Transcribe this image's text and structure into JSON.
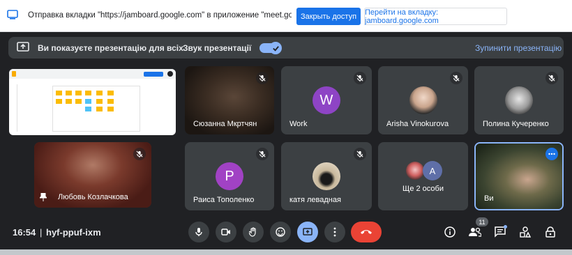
{
  "share_bar": {
    "message": "Отправка вкладки \"https://jamboard.google.com\" в приложение \"meet.google.com\"...",
    "stop_button": "Закрыть доступ",
    "switch_button": "Перейти на вкладку: jamboard.google.com"
  },
  "presentation_bar": {
    "status": "Ви показуєте презентацію для всіх",
    "sound_label": "Звук презентації",
    "sound_on": true,
    "stop_link": "Зупинити презентацію"
  },
  "tiles": [
    {
      "name": "Сюзанна Мкртчян",
      "type": "video",
      "muted": true
    },
    {
      "name": "Work",
      "type": "avatar",
      "initial": "W",
      "color": "#8e44c5",
      "muted": true
    },
    {
      "name": "Arisha Vinokurova",
      "type": "photo",
      "muted": true
    },
    {
      "name": "Полина Кучеренко",
      "type": "photo",
      "muted": true
    },
    {
      "name": "Любовь Козлачкова",
      "type": "video",
      "muted": true
    },
    {
      "name": "Раиса Тополенко",
      "type": "avatar",
      "initial": "P",
      "color": "#a142c4",
      "muted": true
    },
    {
      "name": "катя левадная",
      "type": "photo",
      "muted": true
    },
    {
      "name": "Ще 2 особи",
      "type": "group",
      "initial": "A",
      "muted": false
    },
    {
      "name": "Ви",
      "type": "video",
      "muted": false
    }
  ],
  "meeting": {
    "time": "16:54",
    "code": "hyf-ppuf-ixm",
    "participants_count": "11"
  },
  "colors": {
    "accent": "#8ab4f8",
    "end_call": "#ea4335",
    "tile_bg": "#3c4043",
    "page_bg": "#202124"
  }
}
